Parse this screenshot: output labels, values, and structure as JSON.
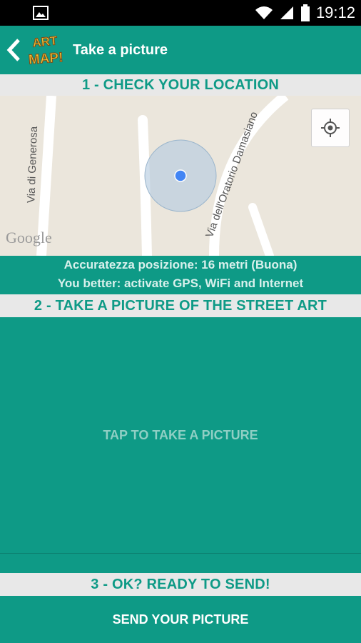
{
  "status_bar": {
    "time": "19:12"
  },
  "app_bar": {
    "title": "Take a picture",
    "logo_text": "ART MAP!"
  },
  "section1": {
    "header": "1 - CHECK YOUR LOCATION"
  },
  "map": {
    "streets": [
      "Via di Generosa",
      "Via dell'Oratorio Damasiano"
    ],
    "attribution": "Google"
  },
  "accuracy": {
    "line1": "Accuratezza posizione: 16 metri (Buona)",
    "line2": "You better: activate GPS, WiFi and Internet"
  },
  "section2": {
    "header": "2 - TAKE A PICTURE OF THE STREET ART",
    "tap_label": "TAP TO TAKE A PICTURE"
  },
  "section3": {
    "header": "3 - OK? READY TO SEND!",
    "send_label": "SEND YOUR PICTURE"
  },
  "colors": {
    "accent": "#0e9a86",
    "header_bg": "#e8e8e8",
    "location_dot": "#4285f4"
  }
}
